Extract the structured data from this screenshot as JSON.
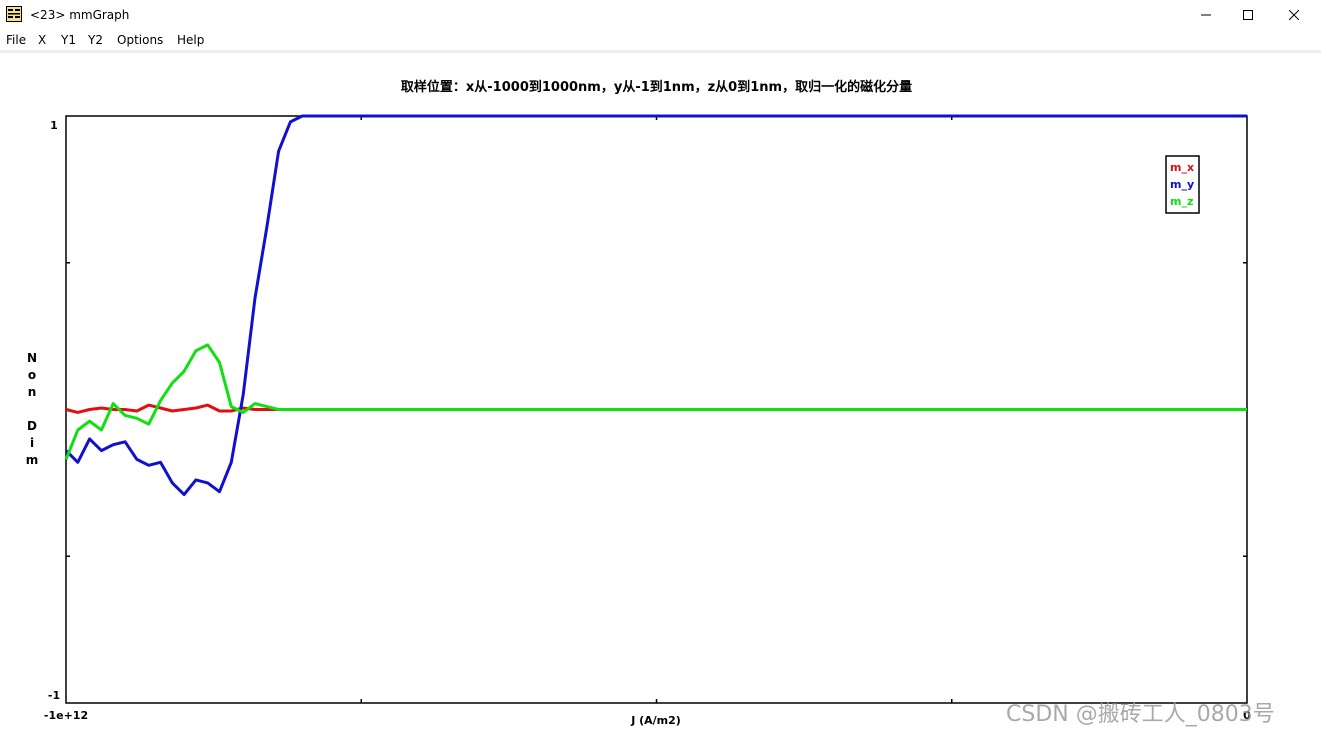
{
  "window": {
    "title": "<23> mmGraph",
    "icon": "graph-app-icon",
    "controls": [
      "minimize-icon",
      "maximize-icon",
      "close-icon"
    ]
  },
  "menu": {
    "items": [
      "File",
      "X",
      "Y1",
      "Y2",
      "Options",
      "Help"
    ]
  },
  "watermark": "CSDN @搬砖工人_0803号",
  "colors": {
    "m_x": "#e01010",
    "m_y": "#1010d0",
    "m_z": "#10e010"
  },
  "chart_data": {
    "type": "line",
    "title": "取样位置：x从-1000到1000nm，y从-1到1nm，z从0到1nm，取归一化的磁化分量",
    "xlabel": "J (A/m2)",
    "ylabel": "N\no\nn\n\nD\ni\nm",
    "x_tick_labels": [
      "-1e+12",
      "0"
    ],
    "y_tick_labels": [
      "1",
      "-1"
    ],
    "xlim": [
      -1000000000000,
      0
    ],
    "ylim": [
      -1,
      1
    ],
    "grid": false,
    "legend": "top-right",
    "x": [
      -1000000000000,
      -990000000000,
      -980000000000,
      -970000000000,
      -960000000000,
      -950000000000,
      -940000000000,
      -930000000000,
      -920000000000,
      -910000000000,
      -900000000000,
      -890000000000,
      -880000000000,
      -870000000000,
      -860000000000,
      -850000000000,
      -840000000000,
      -830000000000,
      -820000000000,
      -810000000000,
      -800000000000,
      -790000000000,
      -780000000000,
      -770000000000,
      -760000000000,
      -750000000000,
      -740000000000,
      -730000000000,
      -720000000000,
      -700000000000,
      -600000000000,
      -500000000000,
      -400000000000,
      -300000000000,
      -200000000000,
      -100000000000,
      0
    ],
    "series": [
      {
        "name": "m_x",
        "values": [
          0.0,
          -0.01,
          0.0,
          0.005,
          0.0,
          0.0,
          -0.005,
          0.015,
          0.005,
          -0.005,
          0.0,
          0.005,
          0.015,
          -0.005,
          -0.005,
          0.005,
          0.0,
          0.0,
          0.0,
          0.0,
          0.0,
          0.0,
          0.0,
          0.0,
          0.0,
          0.0,
          0.0,
          0.0,
          0.0,
          0.0,
          0.0,
          0.0,
          0.0,
          0.0,
          0.0,
          0.0,
          0.0
        ]
      },
      {
        "name": "m_y",
        "values": [
          -0.14,
          -0.18,
          -0.1,
          -0.14,
          -0.12,
          -0.11,
          -0.17,
          -0.19,
          -0.18,
          -0.25,
          -0.29,
          -0.24,
          -0.25,
          -0.28,
          -0.18,
          0.05,
          0.38,
          0.62,
          0.88,
          0.98,
          1.0,
          1.0,
          1.0,
          1.0,
          1.0,
          1.0,
          1.0,
          1.0,
          1.0,
          1.0,
          1.0,
          1.0,
          1.0,
          1.0,
          1.0,
          1.0,
          1.0
        ]
      },
      {
        "name": "m_z",
        "values": [
          -0.17,
          -0.07,
          -0.04,
          -0.07,
          0.02,
          -0.02,
          -0.03,
          -0.05,
          0.03,
          0.09,
          0.13,
          0.2,
          0.22,
          0.16,
          0.01,
          -0.01,
          0.02,
          0.01,
          0.0,
          0.0,
          0.0,
          0.0,
          0.0,
          0.0,
          0.0,
          0.0,
          0.0,
          0.0,
          0.0,
          0.0,
          0.0,
          0.0,
          0.0,
          0.0,
          0.0,
          0.0,
          0.0
        ]
      }
    ]
  }
}
